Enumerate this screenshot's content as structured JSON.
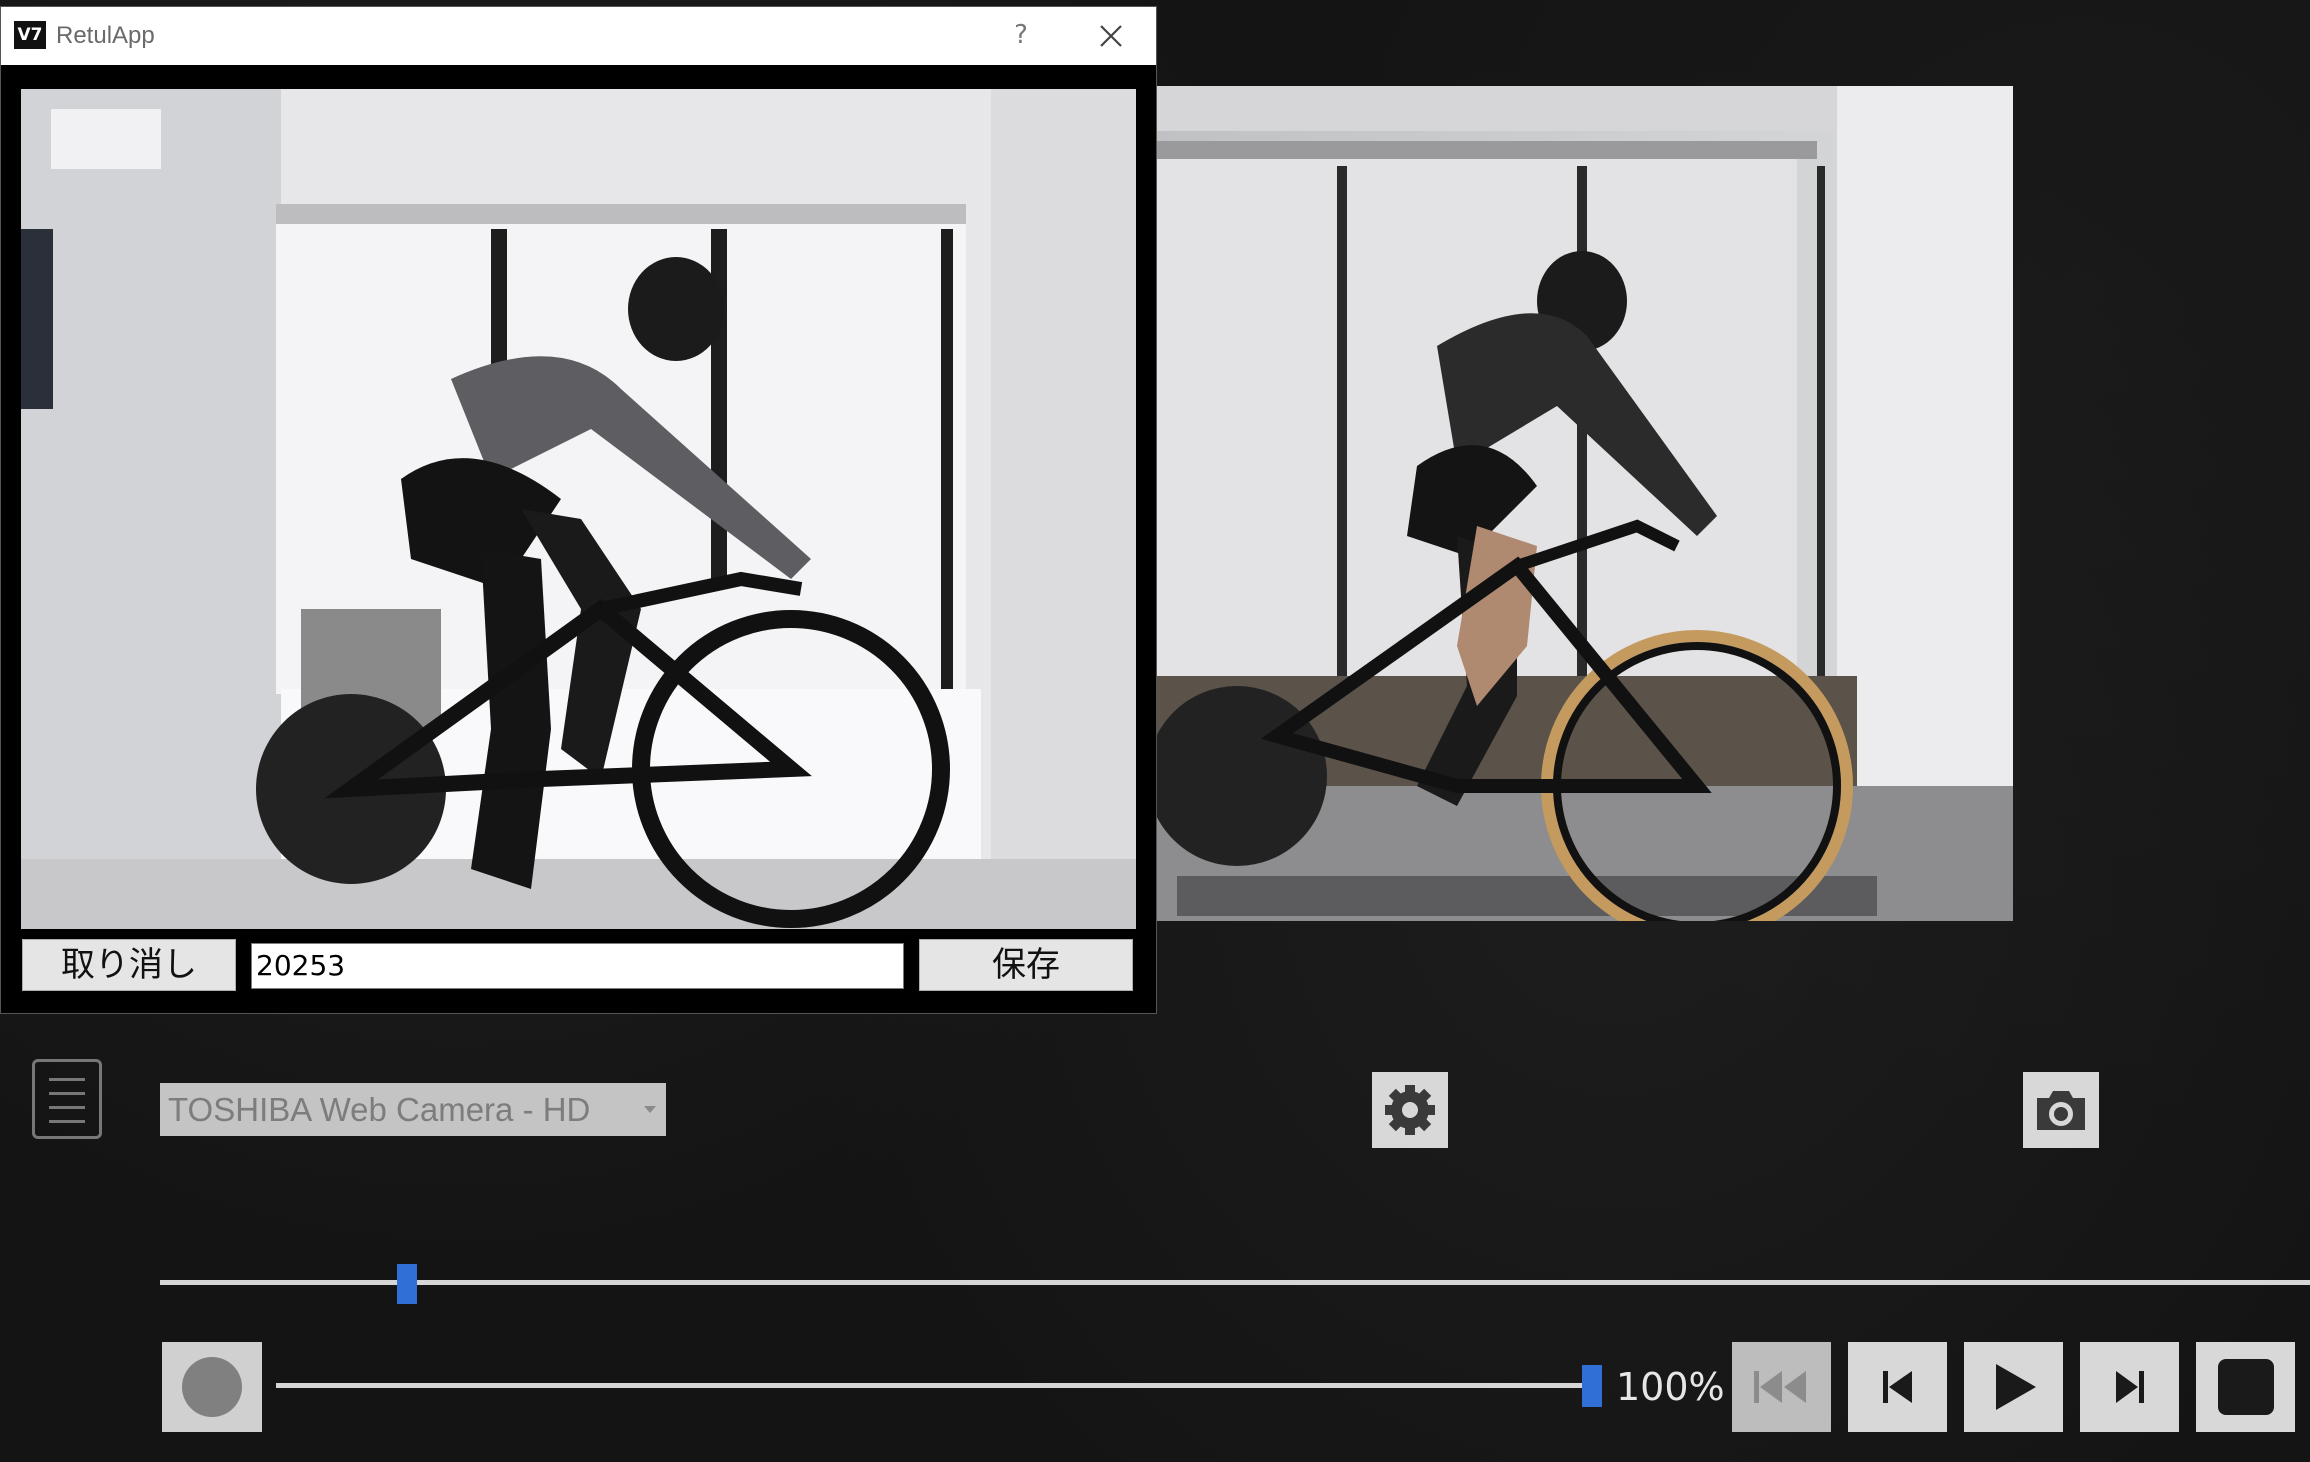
{
  "window": {
    "title": "RetulApp",
    "icon_text": "V7",
    "help_label": "?",
    "close_icon": "close-icon"
  },
  "dialog": {
    "cancel_label": "取り消し",
    "filename_value": "20253",
    "save_label": "保存"
  },
  "camera": {
    "selected": "TOSHIBA Web Camera - HD"
  },
  "playback": {
    "timeline_position": 0.115,
    "speed_fraction": 1.0,
    "speed_label": "100%"
  },
  "icons": {
    "menu": "menu-icon",
    "settings": "gear-icon",
    "snapshot": "camera-icon",
    "record": "record-icon",
    "first": "skip-to-start-icon",
    "prev": "step-back-icon",
    "play": "play-icon",
    "next": "step-forward-icon",
    "stop": "stop-icon"
  },
  "colors": {
    "slider_accent": "#2f6fd6",
    "background": "#141414"
  }
}
